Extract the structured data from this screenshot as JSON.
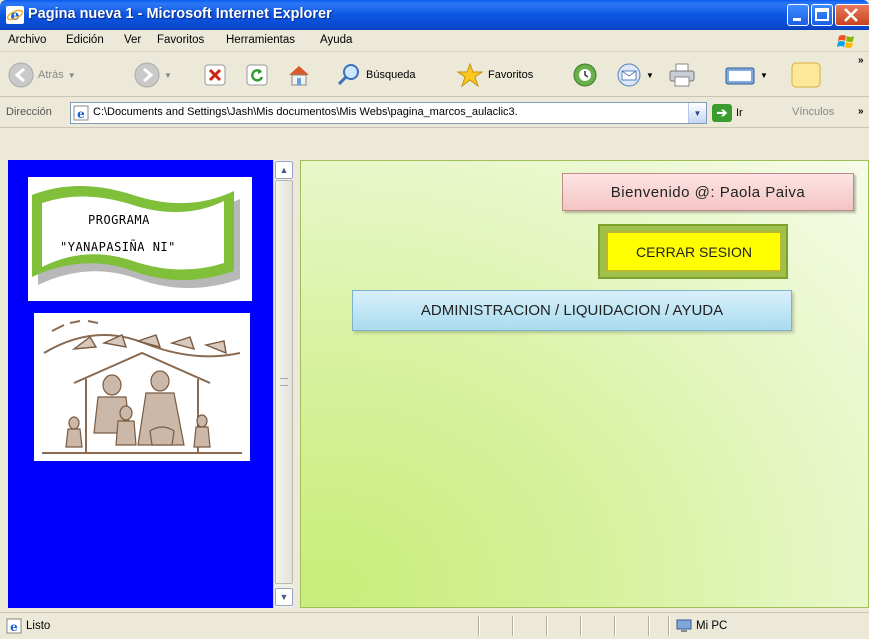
{
  "window": {
    "title": "Pagina nueva 1 - Microsoft Internet Explorer"
  },
  "menu": [
    "Archivo",
    "Edición",
    "Ver",
    "Favoritos",
    "Herramientas",
    "Ayuda"
  ],
  "toolbar": {
    "back_label": "Atrás",
    "search_label": "Búsqueda",
    "favorites_label": "Favoritos"
  },
  "address": {
    "label": "Dirección",
    "value": "C:\\Documents and Settings\\Jash\\Mis documentos\\Mis Webs\\pagina_marcos_aulaclic3.",
    "go_label": "Ir",
    "links_label": "Vínculos"
  },
  "left_frame": {
    "logo_line1": "PROGRAMA",
    "logo_line2": "\"YANAPASIÑA NI\""
  },
  "right_frame": {
    "welcome": "Bienvenido @: Paola Paiva",
    "logout": "CERRAR SESION",
    "admin": "ADMINISTRACION / LIQUIDACION / AYUDA"
  },
  "status": {
    "text": "Listo",
    "zone": "Mi PC"
  },
  "colors": {
    "left_frame_bg": "#0000ff",
    "logout_bg": "#ffff00"
  }
}
